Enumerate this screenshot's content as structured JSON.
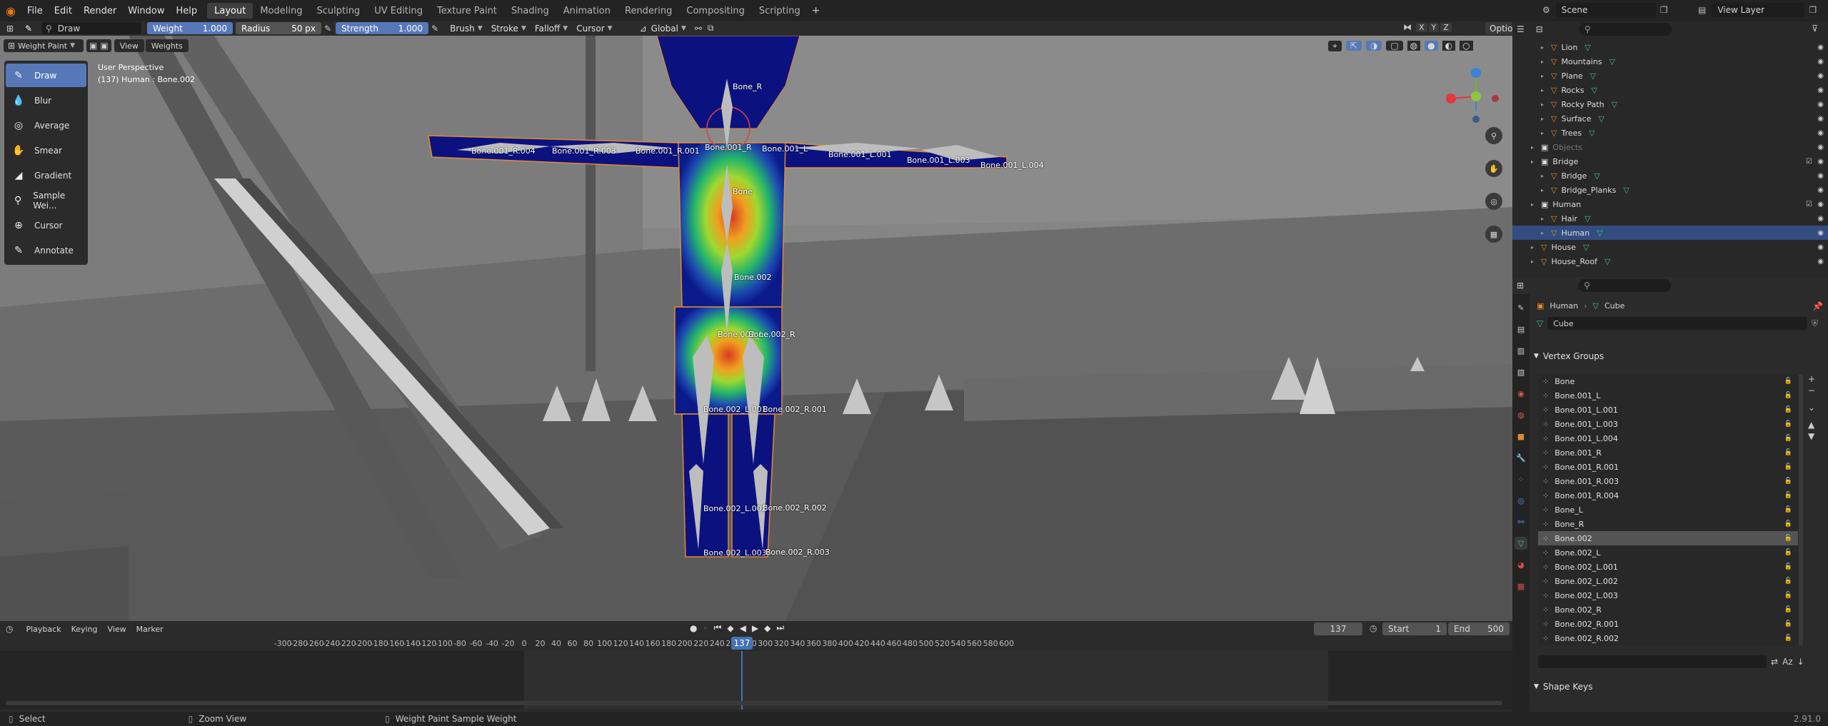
{
  "menu": [
    "File",
    "Edit",
    "Render",
    "Window",
    "Help"
  ],
  "workspaces": [
    "Layout",
    "Modeling",
    "Sculpting",
    "UV Editing",
    "Texture Paint",
    "Shading",
    "Animation",
    "Rendering",
    "Compositing",
    "Scripting"
  ],
  "active_workspace": "Layout",
  "scene_name": "Scene",
  "view_layer": "View Layer",
  "tool_header": {
    "brush_name": "Draw",
    "weight_label": "Weight",
    "weight_value": "1.000",
    "radius_label": "Radius",
    "radius_value": "50 px",
    "strength_label": "Strength",
    "strength_value": "1.000",
    "brush": "Brush",
    "stroke": "Stroke",
    "falloff": "Falloff",
    "cursor": "Cursor",
    "orientation": "Global",
    "axes": [
      "X",
      "Y",
      "Z"
    ],
    "options": "Options"
  },
  "viewport_header": {
    "mode": "Weight Paint",
    "view": "View",
    "weights": "Weights"
  },
  "viewport": {
    "perspective": "User Perspective",
    "info": "(137) Human : Bone.002"
  },
  "tools": [
    "Draw",
    "Blur",
    "Average",
    "Smear",
    "Gradient",
    "Sample Wei...",
    "Cursor",
    "Annotate"
  ],
  "active_tool": "Draw",
  "bone_labels": [
    "Bone_R",
    "Bone.001_R.004",
    "Bone.001_R.003",
    "Bone.001_R.001",
    "Bone.001_R",
    "Bone.001_L",
    "Bone.001_L.001",
    "Bone.001_L.003",
    "Bone.001_L.004",
    "Bone",
    "Bone.002",
    "Bone.002_L",
    "Bone.002_R",
    "Bone.002_L.001",
    "Bone.002_R.001",
    "Bone.002_L.002",
    "Bone.002_R.002",
    "Bone.002_L.003",
    "Bone.002_R.003"
  ],
  "outliner": [
    {
      "name": "Lion",
      "indent": 2,
      "expand": true
    },
    {
      "name": "Mountains",
      "indent": 2,
      "expand": true
    },
    {
      "name": "Plane",
      "indent": 2,
      "expand": true
    },
    {
      "name": "Rocks",
      "indent": 2,
      "expand": true
    },
    {
      "name": "Rocky Path",
      "indent": 2,
      "expand": true
    },
    {
      "name": "Surface",
      "indent": 2,
      "expand": true
    },
    {
      "name": "Trees",
      "indent": 2,
      "expand": true
    },
    {
      "name": "Objects",
      "indent": 1,
      "expand": true,
      "collection": true,
      "dim": true
    },
    {
      "name": "Bridge",
      "indent": 1,
      "expand": true,
      "collection": true
    },
    {
      "name": "Bridge",
      "indent": 2,
      "expand": true
    },
    {
      "name": "Bridge_Planks",
      "indent": 2,
      "expand": true
    },
    {
      "name": "Human",
      "indent": 1,
      "expand": true,
      "collection": true
    },
    {
      "name": "Hair",
      "indent": 2,
      "expand": true
    },
    {
      "name": "Human",
      "indent": 2,
      "expand": true,
      "selected": true
    },
    {
      "name": "House",
      "indent": 1,
      "expand": true
    },
    {
      "name": "House_Roof",
      "indent": 1,
      "expand": true
    }
  ],
  "properties": {
    "object": "Human",
    "data": "Cube",
    "mesh_name": "Cube",
    "vertex_groups_title": "Vertex Groups",
    "shape_keys_title": "Shape Keys",
    "vertex_groups": [
      "Bone",
      "Bone.001_L",
      "Bone.001_L.001",
      "Bone.001_L.003",
      "Bone.001_L.004",
      "Bone.001_R",
      "Bone.001_R.001",
      "Bone.001_R.003",
      "Bone.001_R.004",
      "Bone_L",
      "Bone_R",
      "Bone.002",
      "Bone.002_L",
      "Bone.002_L.001",
      "Bone.002_L.002",
      "Bone.002_L.003",
      "Bone.002_R",
      "Bone.002_R.001",
      "Bone.002_R.002"
    ],
    "selected_group": "Bone.002"
  },
  "timeline": {
    "menus": [
      "Playback",
      "Keying",
      "View",
      "Marker"
    ],
    "current_frame": "137",
    "start_label": "Start",
    "start": "1",
    "end_label": "End",
    "end": "500",
    "ticks": [
      "-300",
      "-280",
      "-260",
      "-240",
      "-220",
      "-200",
      "-180",
      "-160",
      "-140",
      "-120",
      "-100",
      "-80",
      "-60",
      "-40",
      "-20",
      "0",
      "20",
      "40",
      "60",
      "80",
      "100",
      "120",
      "140",
      "160",
      "180",
      "200",
      "220",
      "240",
      "260",
      "280",
      "300",
      "320",
      "340",
      "360",
      "380",
      "400",
      "420",
      "440",
      "460",
      "480",
      "500",
      "520",
      "540",
      "560",
      "580",
      "600"
    ]
  },
  "status": {
    "select": "Select",
    "zoom": "Zoom View",
    "sample": "Weight Paint Sample Weight",
    "version": "2.91.0"
  }
}
